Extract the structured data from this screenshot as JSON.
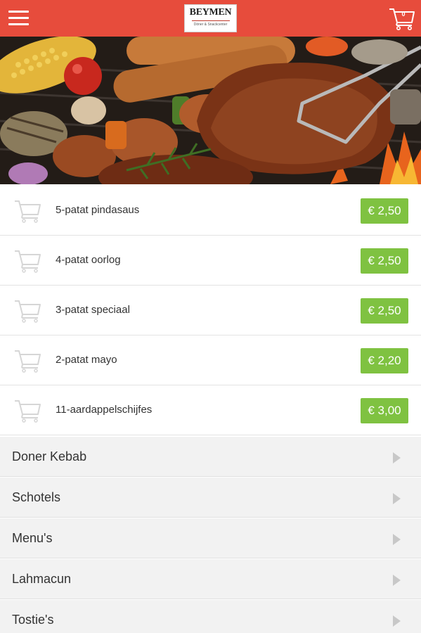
{
  "header": {
    "menu_icon": "hamburger-menu-icon",
    "logo_text": "BEYMEN",
    "logo_subtitle": "Döner & Snackcenter",
    "cart_icon": "shopping-cart-icon",
    "cart_count": "0",
    "bar_color": "#e74c3c"
  },
  "hero": {
    "image": "grilled-meat-barbecue-photo"
  },
  "products": [
    {
      "name": "5-patat pindasaus",
      "price": "€ 2,50"
    },
    {
      "name": "4-patat oorlog",
      "price": "€ 2,50"
    },
    {
      "name": "3-patat speciaal",
      "price": "€ 2,50"
    },
    {
      "name": "2-patat mayo",
      "price": "€ 2,20"
    },
    {
      "name": "11-aardappelschijfes",
      "price": "€ 3,00"
    }
  ],
  "categories": [
    {
      "name": "Doner Kebab"
    },
    {
      "name": "Schotels"
    },
    {
      "name": "Menu's"
    },
    {
      "name": "Lahmacun"
    },
    {
      "name": "Tostie's"
    }
  ],
  "colors": {
    "price_button": "#7fc241",
    "category_bg": "#f2f2f2"
  }
}
